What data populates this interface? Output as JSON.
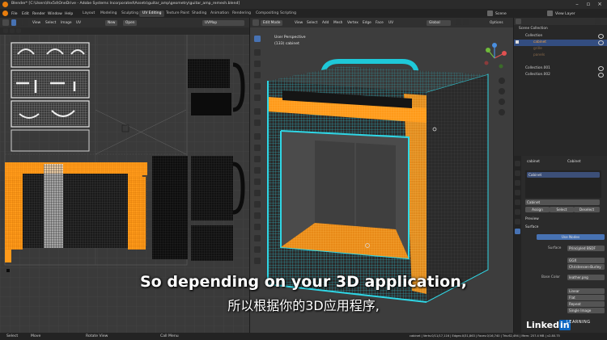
{
  "window": {
    "title": "Blender* [C:\\Users\\lhx5d\\OneDrive - Adobe Systems Incorporated\\Assets\\guitar_amp\\geometry\\guitar_amp_remesh.blend]"
  },
  "menus": [
    "File",
    "Edit",
    "Render",
    "Window",
    "Help"
  ],
  "workspaces": [
    "Layout",
    "Modeling",
    "Sculpting",
    "UV Editing",
    "Texture Paint",
    "Shading",
    "Animation",
    "Rendering",
    "Compositing",
    "Scripting"
  ],
  "active_workspace": "UV Editing",
  "scene": {
    "label": "Scene",
    "view_layer": "View Layer"
  },
  "uv_editor": {
    "header": [
      "View",
      "Select",
      "Image",
      "UV"
    ],
    "new_label": "New",
    "open_label": "Open",
    "uvmap": "UVMap"
  },
  "viewport": {
    "mode": "Edit Mode",
    "menus": [
      "View",
      "Select",
      "Add",
      "Mesh",
      "Vertex",
      "Edge",
      "Face",
      "UV"
    ],
    "transform": "Global",
    "options": "Options",
    "overlay_title": "User Perspective",
    "overlay_object": "(133) cabinet"
  },
  "outliner": {
    "items": [
      {
        "label": "Scene Collection",
        "selected": false
      },
      {
        "label": "Collection",
        "selected": false
      },
      {
        "label": "cabinet",
        "selected": true
      },
      {
        "label": "grille",
        "selected": false
      },
      {
        "label": "panels",
        "selected": false
      },
      {
        "label": "Collection.001",
        "selected": false
      },
      {
        "label": "Collection.002",
        "selected": false
      }
    ]
  },
  "properties": {
    "object": "cabinet",
    "material_top": "Cabinet",
    "material_slot": "Cabinet",
    "slot_item": "Cabinet",
    "buttons": [
      "Assign",
      "Select",
      "Deselect"
    ],
    "preview_label": "Preview",
    "surface_panel": "Surface",
    "use_nodes": "Use Nodes",
    "surface_label": "Surface",
    "surface_value": "Principled BSDF",
    "field_ggx": "GGX",
    "field_burley": "Christensen-Burley",
    "base_color_label": "Base Color",
    "base_color_value": "leather.png",
    "fields": [
      "Linear",
      "Flat",
      "Repeat",
      "Single Image"
    ]
  },
  "status": {
    "left": [
      "Select",
      "Move",
      "Rotate View",
      "Call Menu"
    ],
    "right": "cabinet | Verts:0/11/17,116 | Edges:0/31,863 | Faces:0/16,740 | Tris:62,494 | Mem: 257.4 MB | v2.80.75"
  },
  "subtitles": {
    "line1": "So depending on your 3D application,",
    "line2": "所以根据你的3D应用程序,"
  },
  "watermark": {
    "brand_left": "Linked",
    "brand_in": "in",
    "learning": "LEARNING"
  },
  "colors": {
    "uv_orange": "#ff9a1a",
    "mesh_cyan": "#2fd7e6",
    "selection_blue": "#334d80",
    "active_tool": "#4772b3"
  }
}
